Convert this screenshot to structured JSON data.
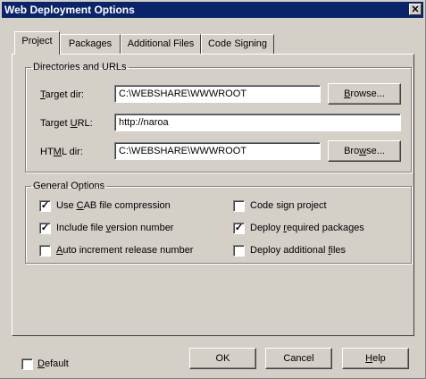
{
  "window": {
    "title": "Web Deployment Options",
    "close_glyph": "✕"
  },
  "tabs": [
    {
      "label": "Project",
      "active": true
    },
    {
      "label": "Packages",
      "active": false
    },
    {
      "label": "Additional Files",
      "active": false
    },
    {
      "label": "Code Signing",
      "active": false
    }
  ],
  "directories": {
    "legend": "Directories and URLs",
    "target_dir": {
      "label_pre": "",
      "label_mn": "T",
      "label_post": "arget dir:",
      "value": "C:\\WEBSHARE\\WWWROOT"
    },
    "target_url": {
      "label_pre": "Target ",
      "label_mn": "U",
      "label_post": "RL:",
      "value": "http://naroa"
    },
    "html_dir": {
      "label_pre": "HT",
      "label_mn": "M",
      "label_post": "L dir:",
      "value": "C:\\WEBSHARE\\WWWROOT"
    },
    "browse1": {
      "pre": "",
      "mn": "B",
      "post": "rowse..."
    },
    "browse2": {
      "pre": "Bro",
      "mn": "w",
      "post": "se..."
    }
  },
  "general": {
    "legend": "General Options",
    "options": [
      {
        "pre": "Use ",
        "mn": "C",
        "post": "AB file compression",
        "checked": true
      },
      {
        "pre": "Include file ",
        "mn": "v",
        "post": "ersion number",
        "checked": true
      },
      {
        "pre": "",
        "mn": "A",
        "post": "uto increment release number",
        "checked": false
      },
      {
        "pre": "Code sign project",
        "mn": "",
        "post": "",
        "checked": false
      },
      {
        "pre": "Deploy ",
        "mn": "r",
        "post": "equired packages",
        "checked": true
      },
      {
        "pre": "Deploy additional ",
        "mn": "f",
        "post": "iles",
        "checked": false
      }
    ]
  },
  "footer": {
    "default": {
      "pre": "",
      "mn": "D",
      "post": "efault",
      "checked": false
    },
    "ok_label": "OK",
    "cancel_label": "Cancel",
    "help": {
      "pre": "",
      "mn": "H",
      "post": "elp"
    }
  }
}
